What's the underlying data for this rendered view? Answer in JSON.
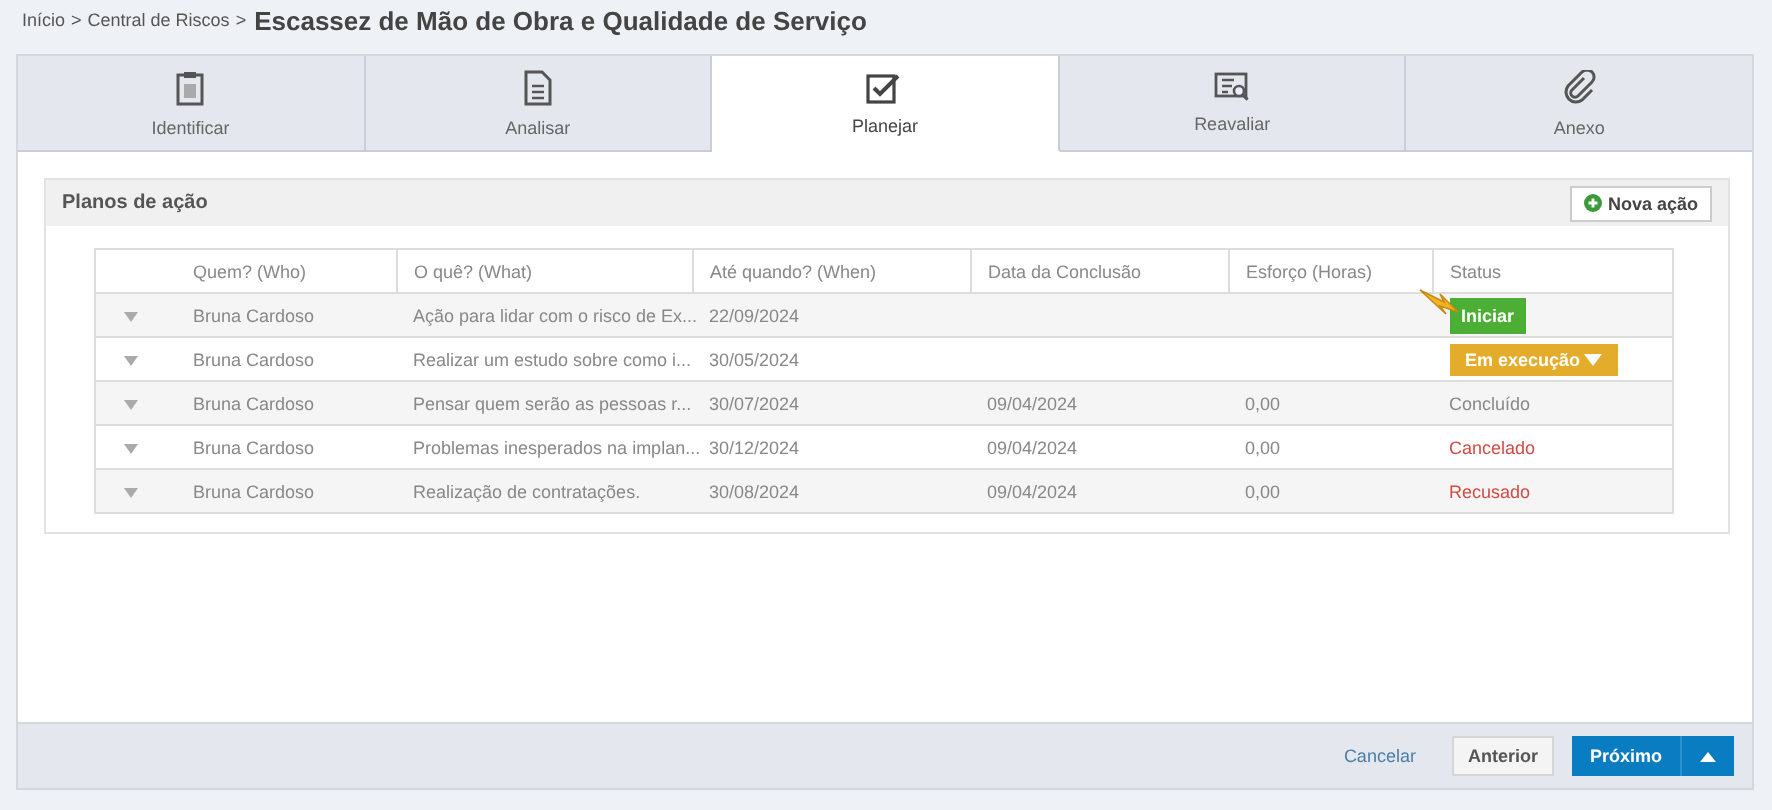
{
  "breadcrumb": {
    "links": [
      "Início",
      "Central de Riscos"
    ],
    "separator": ">",
    "title": "Escassez de Mão de Obra e Qualidade de Serviço"
  },
  "tabs": [
    {
      "label": "Identificar",
      "selected": false
    },
    {
      "label": "Analisar",
      "selected": false
    },
    {
      "label": "Planejar",
      "selected": true
    },
    {
      "label": "Reavaliar",
      "selected": false
    },
    {
      "label": "Anexo",
      "selected": false
    }
  ],
  "panel": {
    "title": "Planos de ação",
    "new_button": "Nova ação"
  },
  "table": {
    "columns": [
      "Quem? (Who)",
      "O quê? (What)",
      "Até quando? (When)",
      "Data da Conclusão",
      "Esforço (Horas)",
      "Status"
    ],
    "rows": [
      {
        "who": "Bruna Cardoso",
        "what": "Ação para lidar com o risco de Ex...",
        "when": "22/09/2024",
        "done": "",
        "effort": "",
        "status": {
          "kind": "start-button",
          "label": "Iniciar",
          "pointer": true
        }
      },
      {
        "who": "Bruna Cardoso",
        "what": "Realizar um estudo sobre como i...",
        "when": "30/05/2024",
        "done": "",
        "effort": "",
        "status": {
          "kind": "running-dropdown",
          "label": "Em execução",
          "pointer": false
        }
      },
      {
        "who": "Bruna Cardoso",
        "what": "Pensar quem serão as pessoas r...",
        "when": "30/07/2024",
        "done": "09/04/2024",
        "effort": "0,00",
        "status": {
          "kind": "done",
          "label": "Concluído",
          "pointer": false
        }
      },
      {
        "who": "Bruna Cardoso",
        "what": "Problemas inesperados na implan...",
        "when": "30/12/2024",
        "done": "09/04/2024",
        "effort": "0,00",
        "status": {
          "kind": "cancelled",
          "label": "Cancelado",
          "pointer": false
        }
      },
      {
        "who": "Bruna Cardoso",
        "what": "Realização de contratações.",
        "when": "30/08/2024",
        "done": "09/04/2024",
        "effort": "0,00",
        "status": {
          "kind": "refused",
          "label": "Recusado",
          "pointer": false
        }
      }
    ]
  },
  "footer": {
    "cancel": "Cancelar",
    "previous": "Anterior",
    "next": "Próximo"
  }
}
